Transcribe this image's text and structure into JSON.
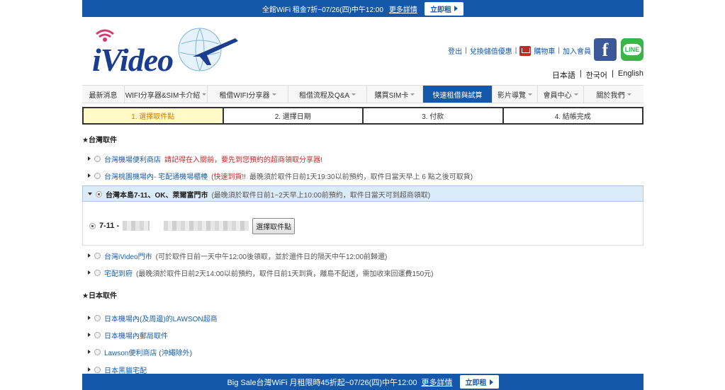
{
  "topbar": {
    "text": "全館WiFi 租金7折~07/26(四)中午12:00",
    "more": "更多詳情",
    "rent": "立即租"
  },
  "header": {
    "logo": "iVideo",
    "links": [
      "登出",
      "兌換儲值優惠",
      "購物車",
      "加入會員"
    ],
    "fb": "f",
    "line": "LINE",
    "langs": [
      "日本語",
      "한국어",
      "English"
    ]
  },
  "nav": [
    {
      "label": "最新消息",
      "caret": false,
      "active": false
    },
    {
      "label": "WIFI分享器&SIM卡介紹",
      "caret": true,
      "active": false
    },
    {
      "label": "租借WIFI分享器",
      "caret": true,
      "active": false
    },
    {
      "label": "租借流程及Q&A",
      "caret": true,
      "active": false
    },
    {
      "label": "購買SIM卡",
      "caret": true,
      "active": false
    },
    {
      "label": "快速租借與試算",
      "caret": false,
      "active": true
    },
    {
      "label": "影片導覽",
      "caret": true,
      "active": false
    },
    {
      "label": "會員中心",
      "caret": true,
      "active": false
    },
    {
      "label": "關於我們",
      "caret": true,
      "active": false
    }
  ],
  "steps": [
    "1. 選擇取件點",
    "2. 選擇日期",
    "3. 付款",
    "4. 結帳完成"
  ],
  "taiwan": {
    "title": "★台灣取件",
    "opt1": {
      "name": "台灣機場便利商店",
      "note": "請記得在入關前，要先到您預約的超商領取分享器!"
    },
    "opt2": {
      "name": "台灣桃園機場內- 宅配通機場櫃檯",
      "flag": "(快速到貨!!",
      "note": "最晚須於取件日前1天19:30以前預約，取件日當天早上 6 點之後可取貨)"
    },
    "opt3": {
      "name": "台灣本島7-11、OK、萊爾富門市",
      "note": "(最晚須於取件日前1~2天早上10:00前預約，取件日當天可到超商領取)"
    },
    "store": {
      "prefix": "7-11 -",
      "button": "選擇取件點"
    },
    "opt4": {
      "name": "台灣iVideo門市",
      "note": "(可於取件日前一天中午12:00後領取，並於還件日的隔天中午12:00前歸還)"
    },
    "opt5": {
      "name": "宅配到府",
      "note": "(最晚須於取件日前2天14:00以前預約，取件日前1天到貨，離島不配送，需加收來回運費150元)"
    }
  },
  "japan": {
    "title": "★日本取件",
    "opts": [
      "日本機場內(及周邊)的LAWSON超商",
      "日本機場內郵局取件",
      "Lawson便利商店 (沖繩除外)",
      "日本黑貓宅配"
    ]
  },
  "bottombar": {
    "text": "Big Sale台灣WiFi 月租限時45折起~07/26(四)中午12:00",
    "more": "更多詳情",
    "rent": "立即租"
  }
}
